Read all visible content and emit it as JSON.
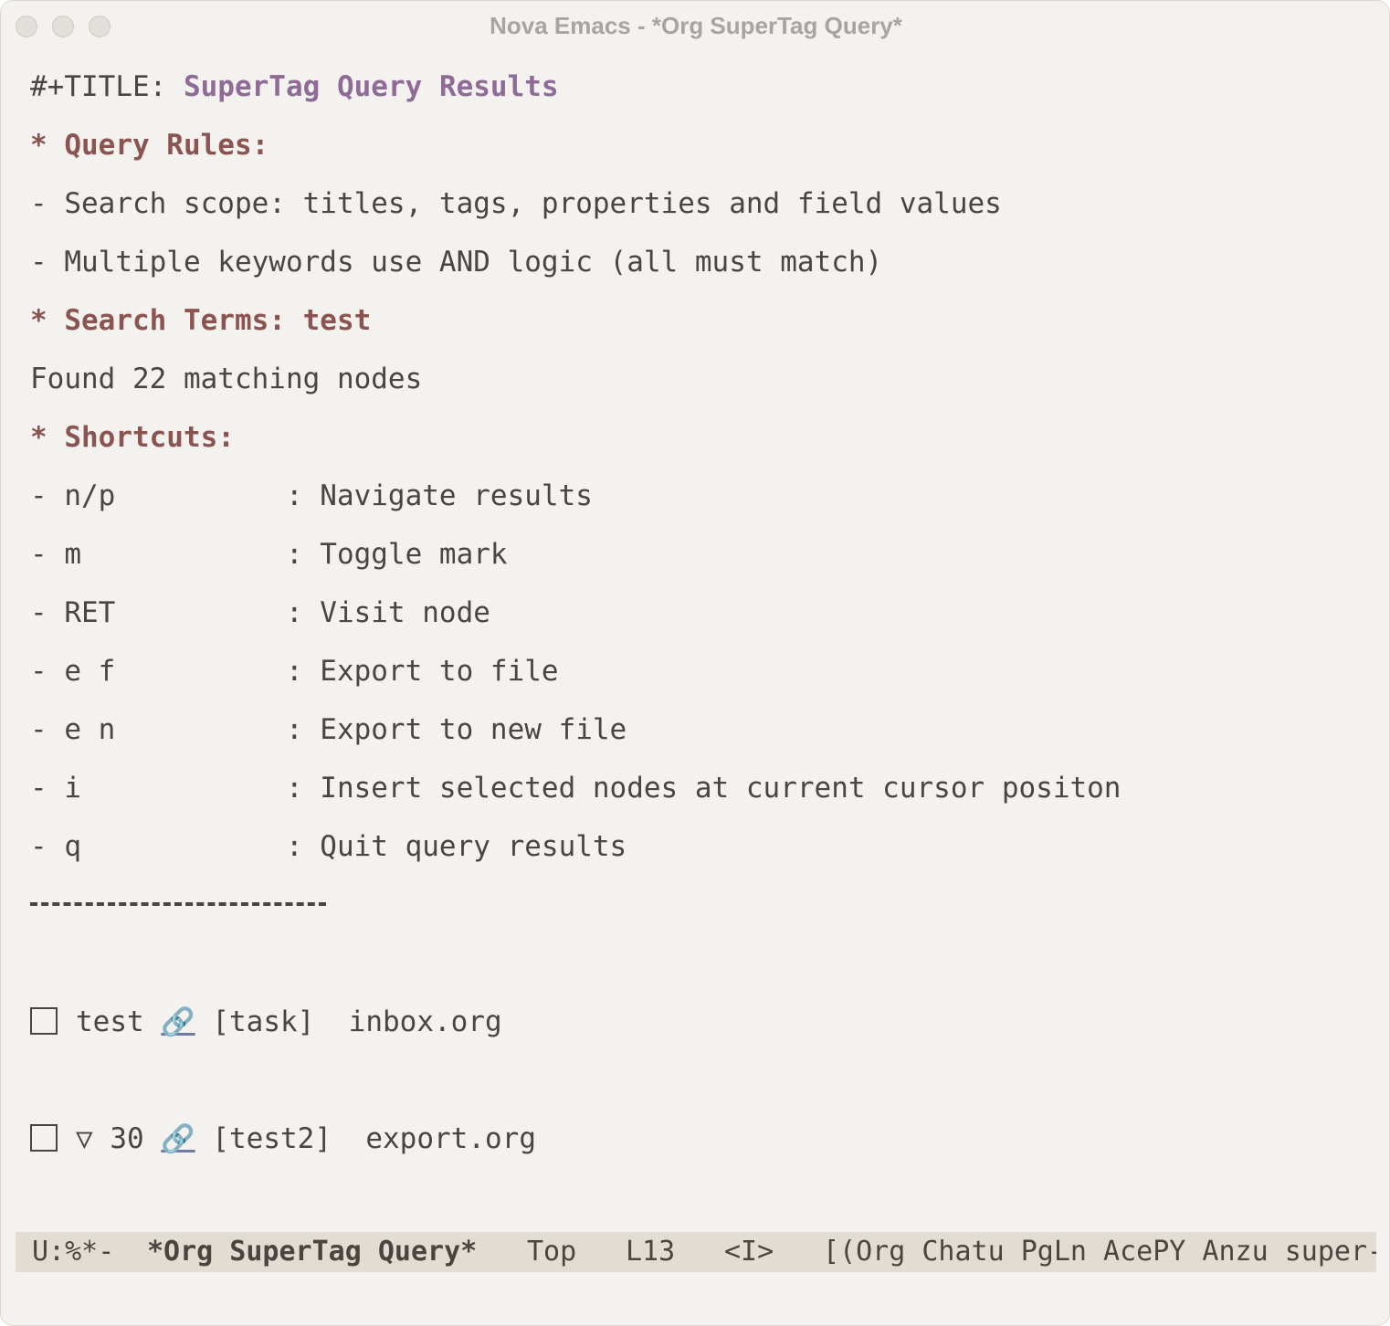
{
  "window": {
    "title": "Nova Emacs - *Org SuperTag Query*"
  },
  "buffer": {
    "title_keyword": "#+TITLE: ",
    "title_value": "SuperTag Query Results",
    "query_rules_heading": "* Query Rules:",
    "rule_1": "- Search scope: titles, tags, properties and field values",
    "rule_2": "- Multiple keywords use AND logic (all must match)",
    "search_terms_heading": "* Search Terms: test",
    "found_text": "Found 22 matching nodes",
    "shortcuts_heading": "* Shortcuts:",
    "shortcuts": [
      "- n/p          : Navigate results",
      "- m            : Toggle mark",
      "- RET          : Visit node",
      "- e f          : Export to file",
      "- e n          : Export to new file",
      "- i            : Insert selected nodes at current cursor positon",
      "- q            : Quit query results"
    ],
    "results": [
      {
        "prefix": "",
        "title": "test",
        "tag": "[task]",
        "file": "inbox.org",
        "checked": false
      },
      {
        "prefix": "▽ ",
        "title": "30",
        "tag": "[test2]",
        "file": "export.org",
        "checked": false
      }
    ],
    "link_icon": "link-icon"
  },
  "modeline": {
    "state": "U:%*-",
    "buffer_name": "*Org SuperTag Query*",
    "position": "Top",
    "line": "L13",
    "input_mode": "<I>",
    "modes": "[(Org Chatu PgLn AcePY Anzu super-"
  }
}
